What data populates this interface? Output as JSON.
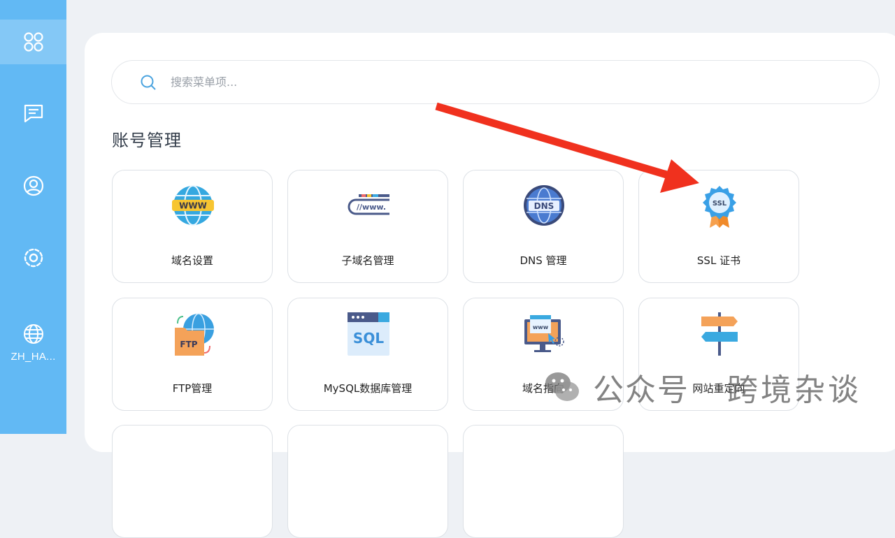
{
  "sidebar": {
    "items": [
      {
        "icon": "apps-grid-icon"
      },
      {
        "icon": "message-icon"
      },
      {
        "icon": "user-circle-icon"
      },
      {
        "icon": "settings-gear-icon"
      },
      {
        "icon": "globe-icon",
        "label": "ZH_HA..."
      }
    ]
  },
  "search": {
    "placeholder": "搜索菜单项..."
  },
  "section": {
    "title": "账号管理"
  },
  "cards": [
    {
      "label": "域名设置",
      "icon": "www-globe-icon"
    },
    {
      "label": "子域名管理",
      "icon": "subdomain-www-icon"
    },
    {
      "label": "DNS 管理",
      "icon": "dns-globe-icon"
    },
    {
      "label": "SSL 证书",
      "icon": "ssl-badge-icon"
    },
    {
      "label": "FTP管理",
      "icon": "ftp-folder-icon"
    },
    {
      "label": "MySQL数据库管理",
      "icon": "sql-window-icon"
    },
    {
      "label": "域名指向",
      "icon": "domain-pointer-icon"
    },
    {
      "label": "网站重定向",
      "icon": "signpost-icon"
    }
  ],
  "watermark": {
    "text1": "公众号",
    "text2": "跨境杂谈"
  },
  "colors": {
    "sidebar": "#62b9f4",
    "arrow": "#f0311e",
    "accent": "#4a90d9"
  }
}
